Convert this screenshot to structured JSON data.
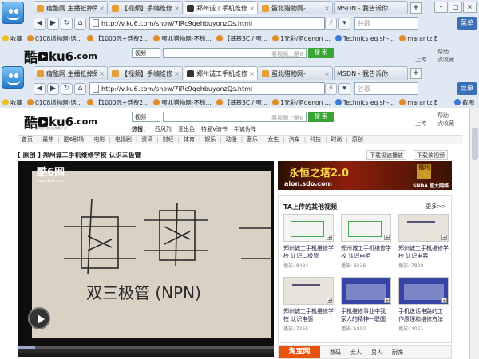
{
  "browser": {
    "tabs": [
      {
        "label": "瘤酷网 主播抵掉到",
        "active": false
      },
      {
        "label": "【视频】手编维修子",
        "active": false
      },
      {
        "label": "郑州诚工手机维修",
        "active": true
      },
      {
        "label": "蛋北猎物网-",
        "active": false
      },
      {
        "label": "MSDN - 我告诉你",
        "active": false
      }
    ],
    "url": "http://v.ku6.com/show/7iRc9qehbuyonzQs.html",
    "search_placeholder": "谷歌",
    "menu_label": "菜单",
    "favorites_label": "收藏",
    "bookmarks": [
      "0108增物网-话...",
      "【1000元+话费2...",
      "蛋北猎物网-不锈...",
      "【基基3C / 蛋...",
      "1元彩/拒denon ...",
      "Technics eq sh-...",
      "marantz E"
    ],
    "extra_label": "截图"
  },
  "site": {
    "logo": {
      "cn": "酷",
      "en": "ku6",
      "dot": ".com",
      "sub": "国内主流在线视频平台"
    },
    "search_select": "视频",
    "search_hint": "看视频上酷6",
    "search_button": "搜 索",
    "upload": "上传",
    "help": "帮助",
    "favorite": "点收藏",
    "hot_label": "热搜：",
    "hot": [
      "西风烈",
      "爱出色",
      "特爱V骑书",
      "半诚伪阵"
    ],
    "nav": [
      "首页",
      "最热",
      "酷6剧场",
      "电影",
      "电视剧",
      "资讯",
      "财经",
      "体育",
      "娱乐",
      "动漫",
      "音乐",
      "女生",
      "汽车",
      "科技",
      "时尚",
      "原创"
    ],
    "video_title": "[ 原创 ]  郑州诚工手机维修学校 认识三极管",
    "dl_fast": "下载极速播放",
    "dl_video": "下载该视频",
    "player": {
      "logo": "酷6网",
      "logo_sub": "www.ku6.com",
      "handwriting": "双三极管 (NPN)"
    },
    "progress": 0.07,
    "ad": {
      "title": "永恒之塔2.0",
      "sub": "aion.sdo.com",
      "corner": "SNDA 盛大网络",
      "badge": "福利"
    },
    "uploader_box": {
      "title": "TA上传的其他视频",
      "more": "更多>>",
      "items": [
        {
          "title": "郑州诚工手机维修学校 认识二极管",
          "plays": "播放: 8484"
        },
        {
          "title": "郑州诚工手机维修学校 认识电阻",
          "plays": "播放: 8236"
        },
        {
          "title": "郑州诚工手机维修学校 认识电容",
          "plays": "播放: 7828"
        },
        {
          "title": "郑州诚工手机维修学校 认识电感",
          "plays": "播放: 7265"
        },
        {
          "title": "手机维修事业中我 家人的精神一联国",
          "plays": "播放: 1890"
        },
        {
          "title": "手机送话电路的工 作原理和维修方法",
          "plays": "播放: 4021"
        }
      ]
    },
    "taobao": {
      "logo": "淘宝网",
      "items": [
        "数码",
        "女人",
        "男人",
        "耐饰"
      ]
    }
  },
  "colors": {
    "accent": "#3b6fb6",
    "search_green": "#3aa534",
    "taobao": "#e8540f"
  }
}
